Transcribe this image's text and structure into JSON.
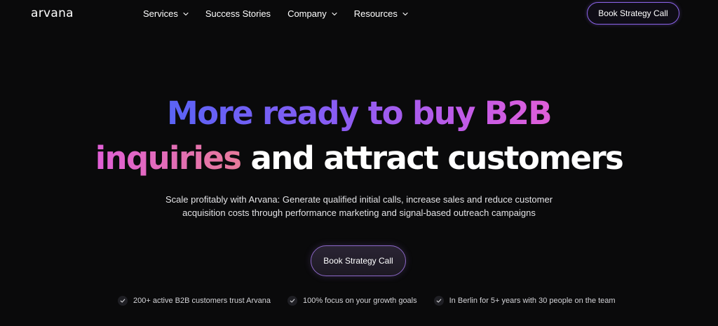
{
  "header": {
    "logo": "arvana",
    "nav": [
      {
        "label": "Services",
        "has_dropdown": true
      },
      {
        "label": "Success Stories",
        "has_dropdown": false
      },
      {
        "label": "Company",
        "has_dropdown": true
      },
      {
        "label": "Resources",
        "has_dropdown": true
      }
    ],
    "cta_label": "Book Strategy Call"
  },
  "hero": {
    "title_line1": "More ready to buy B2B",
    "title_line2_highlight": "inquiries",
    "title_line2_rest": " and attract customers",
    "subtitle": "Scale profitably with Arvana: Generate qualified initial calls, increase sales and reduce customer acquisition costs through performance marketing and signal-based outreach campaigns",
    "cta_label": "Book Strategy Call",
    "proof_points": [
      "200+ active B2B customers trust Arvana",
      "100% focus on your growth goals",
      "In Berlin for 5+ years with 30 people on the team"
    ]
  },
  "colors": {
    "background": "#0a0a0b",
    "gradient_start": "#5a63f6",
    "gradient_mid": "#c55be6",
    "gradient_end": "#e87a9b",
    "cta_border": "#8b63e8"
  },
  "icons": {
    "nav_dropdown": "chevron-down-icon",
    "proof": "check-icon"
  }
}
